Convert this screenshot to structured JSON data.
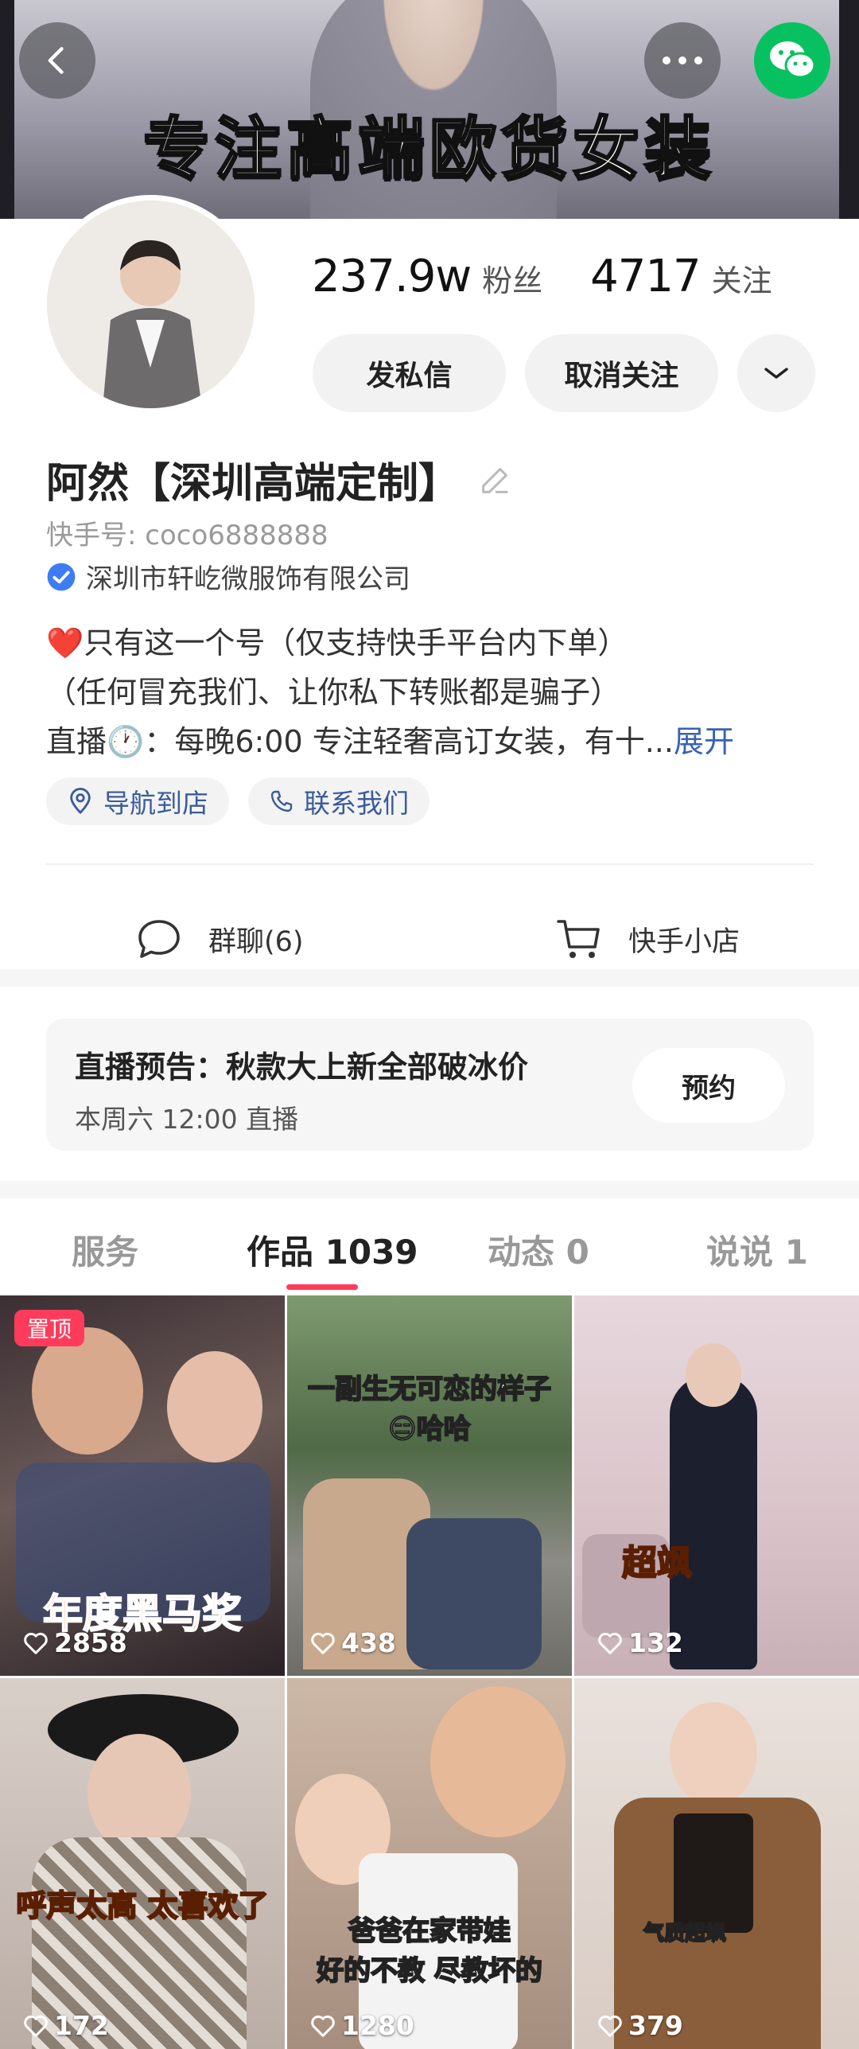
{
  "banner": {
    "text": "专注高端欧货女装"
  },
  "header_buttons": {
    "back_icon": "chevron-left-icon",
    "more_icon": "more-horizontal-icon",
    "wechat_icon": "wechat-icon",
    "wechat_color": "#07c160"
  },
  "profile": {
    "stats": {
      "fans_count": "237.9w",
      "fans_label": "粉丝",
      "following_count": "4717",
      "following_label": "关注"
    },
    "buttons": {
      "message": "发私信",
      "unfollow": "取消关注"
    },
    "name": "阿然【深圳高端定制】",
    "kuaishou_id": "快手号: coco6888888",
    "verified_company": "深圳市轩屹微服饰有限公司",
    "bio_lines": [
      "❤️只有这一个号（仅支持快手平台内下单）",
      "（任何冒充我们、让你私下转账都是骗子）",
      "直播🕐：每晚6:00 专注轻奢高订女装，有十..."
    ],
    "bio_expand": "展开",
    "tags": {
      "navigate": "导航到店",
      "contact": "联系我们"
    },
    "actions": {
      "group_chat": "群聊(6)",
      "shop": "快手小店"
    }
  },
  "live_notice": {
    "title": "直播预告：秋款大上新全部破冰价",
    "time": "本周六 12:00 直播",
    "button": "预约"
  },
  "tabs": [
    {
      "label": "服务"
    },
    {
      "label": "作品 1039"
    },
    {
      "label": "动态 0"
    },
    {
      "label": "说说 1"
    }
  ],
  "accent_color": "#ff3b5c",
  "link_color": "#3662b5",
  "videos": [
    {
      "likes": "2858",
      "pinned_label": "置顶",
      "caption": "年度黑马奖"
    },
    {
      "likes": "438",
      "caption": "一副生无可恋的样子",
      "caption2": "😑哈哈"
    },
    {
      "likes": "132",
      "caption": "超飒"
    },
    {
      "likes": "172",
      "caption": "呼声太高 太喜欢了"
    },
    {
      "likes": "1280",
      "caption": "爸爸在家带娃",
      "caption2": "好的不教 尽教坏的"
    },
    {
      "likes": "379",
      "caption": "气质超飒"
    }
  ]
}
